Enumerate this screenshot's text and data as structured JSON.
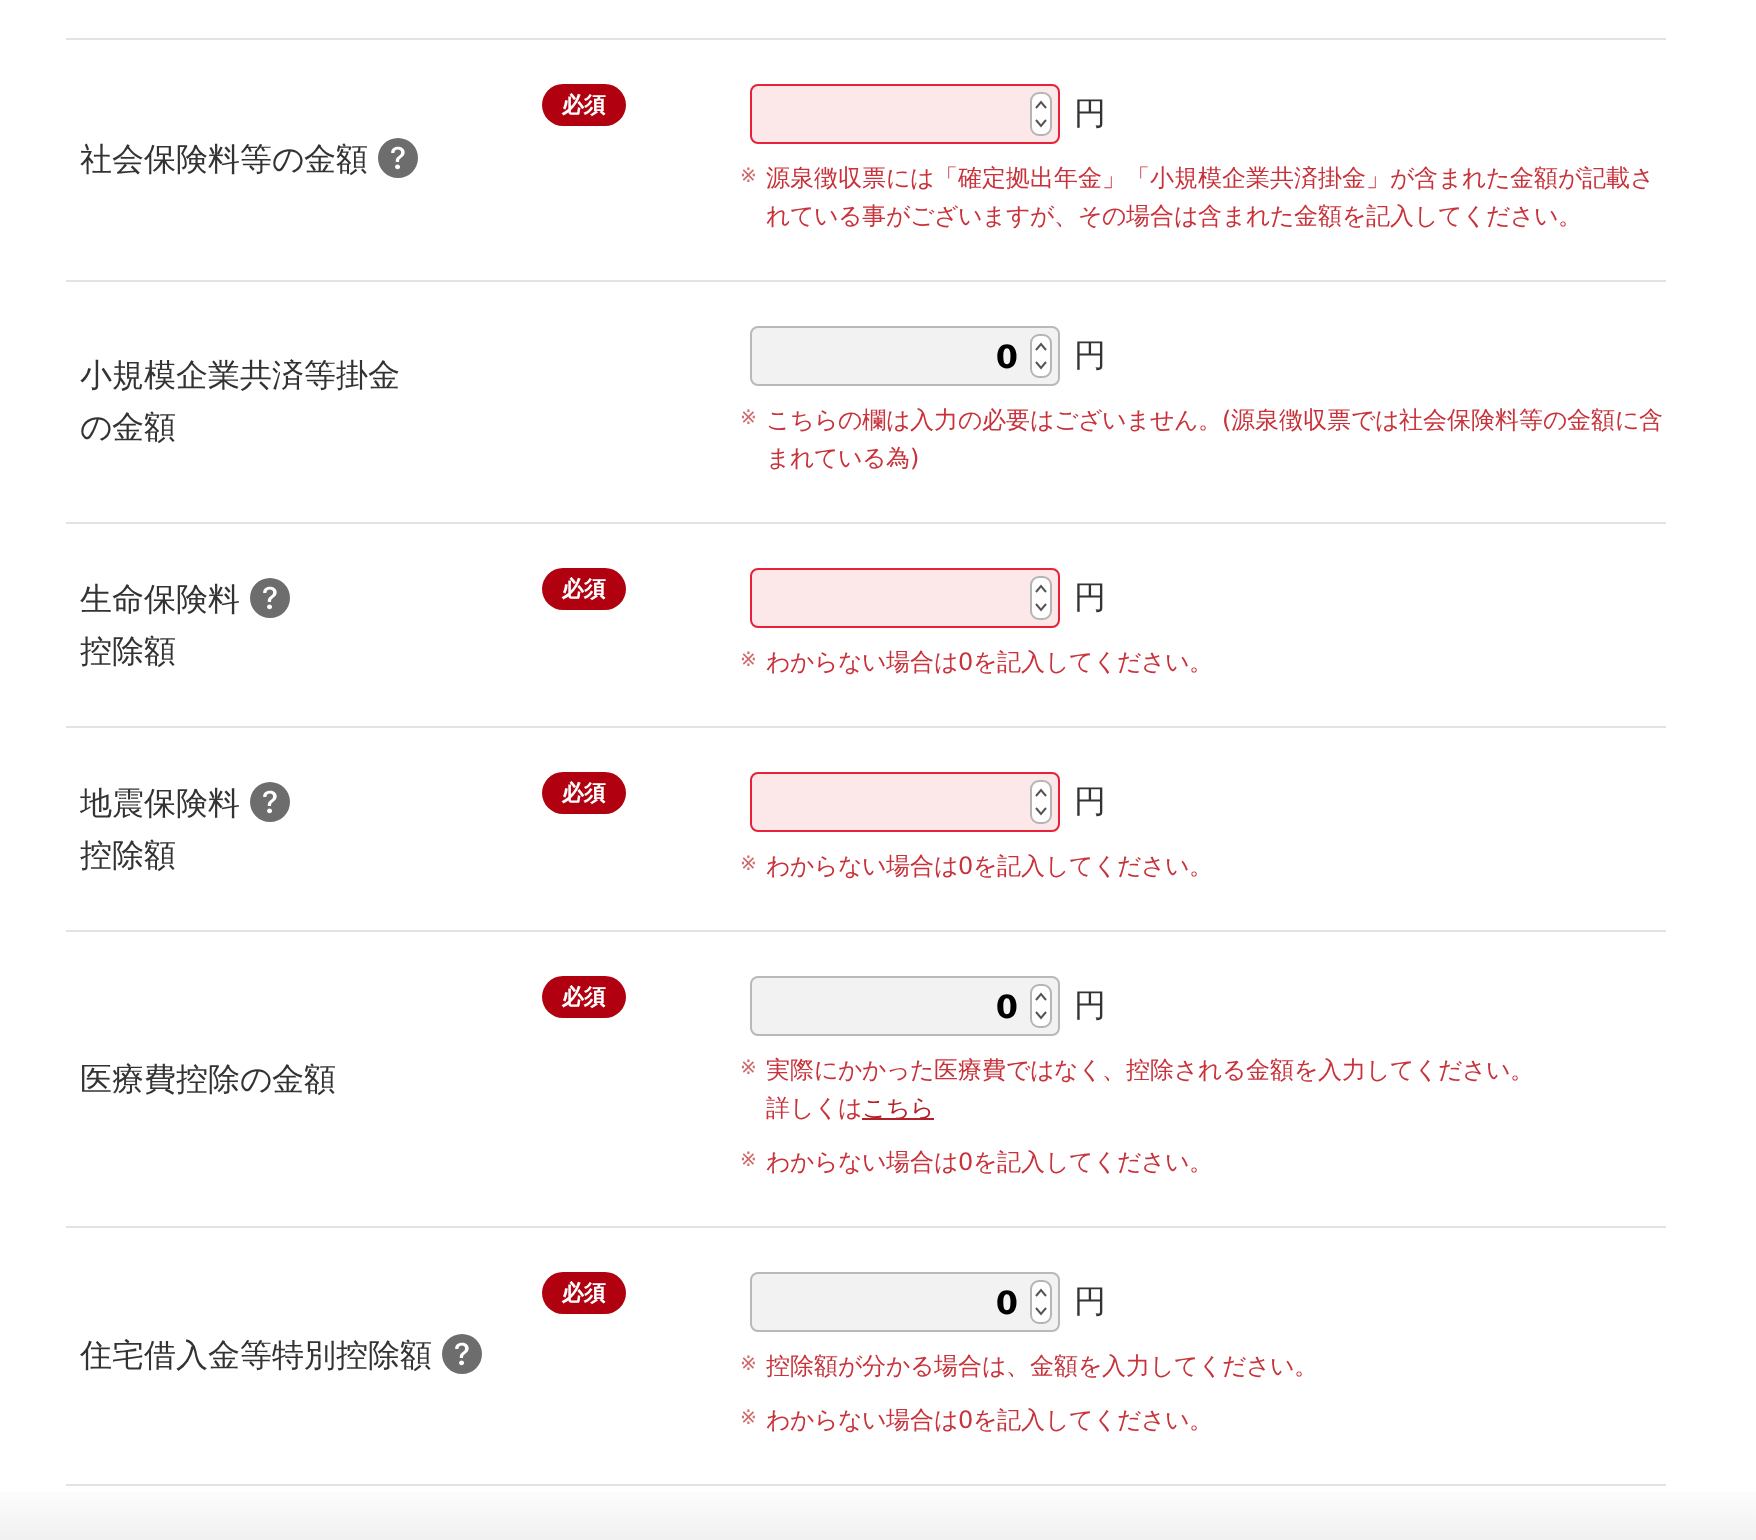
{
  "rows": [
    {
      "label_lines": [
        "社会保険料等の金額"
      ],
      "help": true,
      "badge": "必須",
      "input": {
        "error": true
      },
      "unit": "円",
      "notes": [
        {
          "mark": "※",
          "text": "源泉徴収票には「確定拠出年金」「小規模企業共済掛金」が含まれた金額が記載されている事がございますが、その場合は含まれた金額を記入してください。"
        }
      ]
    },
    {
      "label_lines": [
        "小規模企業共済等掛金",
        "の金額"
      ],
      "help": false,
      "input": {
        "value": "0",
        "error": false
      },
      "unit": "円",
      "notes": [
        {
          "mark": "※",
          "text": "こちらの欄は入力の必要はございません。(源泉徴収票では社会保険料等の金額に含まれている為)"
        }
      ]
    },
    {
      "label_lines": [
        "生命保険料",
        "控除額"
      ],
      "help": true,
      "badge": "必須",
      "input": {
        "error": true
      },
      "unit": "円",
      "notes": [
        {
          "mark": "※",
          "text": "わからない場合は0を記入してください。"
        }
      ]
    },
    {
      "label_lines": [
        "地震保険料",
        "控除額"
      ],
      "help": true,
      "badge": "必須",
      "input": {
        "error": true
      },
      "unit": "円",
      "notes": [
        {
          "mark": "※",
          "text": "わからない場合は0を記入してください。"
        }
      ]
    },
    {
      "label_lines": [
        "医療費控除の金額"
      ],
      "help": false,
      "badge": "必須",
      "input": {
        "value": "0",
        "error": false
      },
      "unit": "円",
      "notes": [
        {
          "mark": "※",
          "text": "実際にかかった医療費ではなく、控除される金額を入力してください。",
          "more": "詳しくは",
          "link": "こちら"
        },
        {
          "mark": "※",
          "text": "わからない場合は0を記入してください。"
        }
      ]
    },
    {
      "label_lines": [
        "住宅借入金等特別控除額"
      ],
      "help": true,
      "badge": "必須",
      "input": {
        "value": "0",
        "error": false
      },
      "unit": "円",
      "notes": [
        {
          "mark": "※",
          "text": "控除額が分かる場合は、金額を入力してください。"
        },
        {
          "mark": "※",
          "text": "わからない場合は0を記入してください。"
        }
      ]
    }
  ]
}
